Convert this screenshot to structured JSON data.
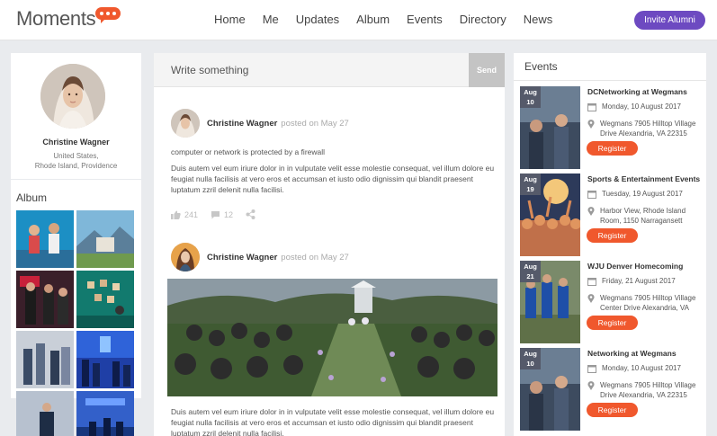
{
  "app": {
    "logo_text": "Moments"
  },
  "nav": {
    "items": [
      "Home",
      "Me",
      "Updates",
      "Album",
      "Events",
      "Directory",
      "News"
    ]
  },
  "header": {
    "invite_label": "Invite Alumni"
  },
  "profile": {
    "name": "Christine Wagner",
    "location_line1": "United States,",
    "location_line2": "Rhode Island, Providence"
  },
  "album": {
    "title": "Album"
  },
  "composer": {
    "placeholder": "Write something",
    "send_label": "Send"
  },
  "posts": [
    {
      "author": "Christine Wagner",
      "date": "posted on May 27",
      "lead": "computer or network is protected by a firewall",
      "body": "Duis autem vel eum iriure dolor in in vulputate velit esse molestie consequat, vel illum dolore eu feugiat nulla facilisis at vero eros et accumsan et iusto odio dignissim qui blandit praesent luptatum zzril delenit nulla facilisi.",
      "likes": "241",
      "comments": "12"
    },
    {
      "author": "Christine Wagner",
      "date": "posted on May 27",
      "body": "Duis autem vel eum iriure dolor in in vulputate velit esse molestie consequat, vel illum dolore eu feugiat nulla facilisis at vero eros et accumsan et iusto odio dignissim qui blandit praesent luptatum zzril delenit nulla facilisi."
    }
  ],
  "events": {
    "title": "Events",
    "register_label": "Register",
    "items": [
      {
        "month": "Aug",
        "day": "10",
        "title": "DCNetworking at Wegmans",
        "date": "Monday, 10 August 2017",
        "address1": "Wegmans 7905 Hilltop Village",
        "address2": "Drive Alexandria, VA 22315"
      },
      {
        "month": "Aug",
        "day": "19",
        "title": "Sports & Entertainment Events",
        "date": "Tuesday, 19 August 2017",
        "address1": "Harbor View, Rhode Island",
        "address2": "Room, 1150 Narragansett"
      },
      {
        "month": "Aug",
        "day": "21",
        "title": "WJU Denver Homecoming",
        "date": "Friday, 21 August 2017",
        "address1": "Wegmans 7905 Hilltop Village",
        "address2": "Center Drive Alexandria, VA"
      },
      {
        "month": "Aug",
        "day": "10",
        "title": "Networking at Wegmans",
        "date": "Monday, 10 August 2017",
        "address1": "Wegmans 7905 Hilltop Village",
        "address2": "Drive Alexandria, VA 22315"
      }
    ]
  },
  "icons": {
    "logo": "speech-bubble-icon",
    "like": "thumbs-up-icon",
    "comment": "comment-icon",
    "share": "share-icon",
    "calendar": "calendar-icon",
    "location": "location-pin-icon"
  },
  "colors": {
    "brand_purple": "#6d4ac1",
    "accent_orange": "#f0582d",
    "date_badge": "#555a6a",
    "page_background": "#e9ebee"
  }
}
